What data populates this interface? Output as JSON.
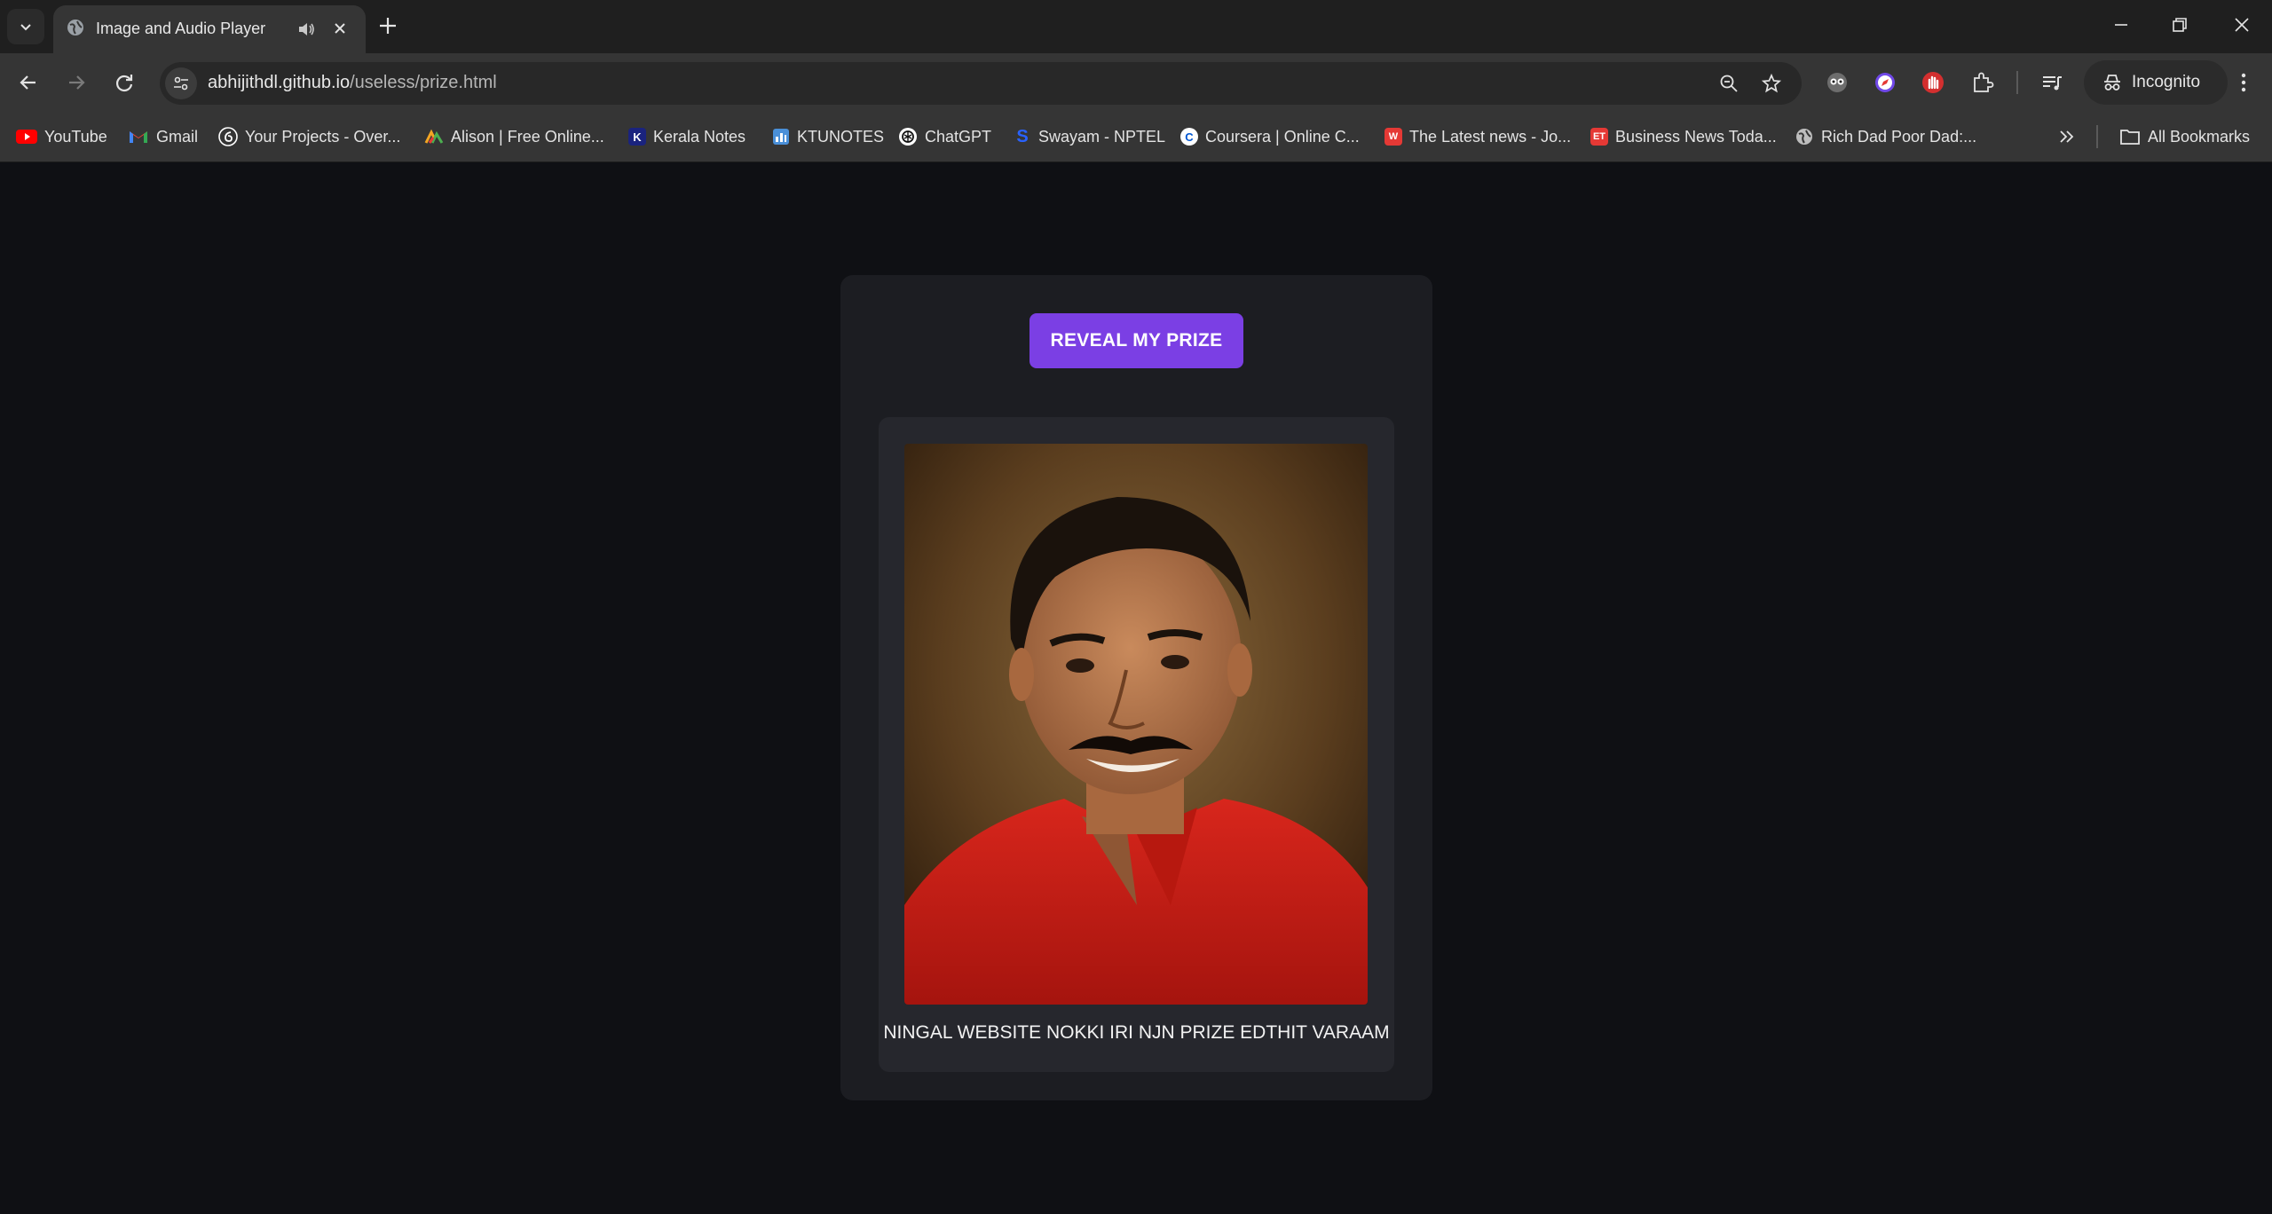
{
  "browser": {
    "tab_title": "Image and Audio Player",
    "url_host": "abhijithdl.github.io",
    "url_path": "/useless/prize.html",
    "mode_label": "Incognito"
  },
  "bookmarks": [
    {
      "label": "YouTube",
      "icon": "youtube-icon",
      "color": "#ff0000"
    },
    {
      "label": "Gmail",
      "icon": "gmail-icon",
      "color": "#ea4335"
    },
    {
      "label": "Your Projects - Over...",
      "icon": "projects-icon",
      "color": "#ffffff"
    },
    {
      "label": "Alison | Free Online...",
      "icon": "alison-icon",
      "color": "#f5a623"
    },
    {
      "label": "Kerala Notes",
      "icon": "kerala-notes-icon",
      "color": "#1a237e",
      "glyph": "K"
    },
    {
      "label": "KTUNOTES",
      "icon": "ktunotes-icon",
      "color": "#4a90d9"
    },
    {
      "label": "ChatGPT",
      "icon": "chatgpt-icon",
      "color": "#ffffff"
    },
    {
      "label": "Swayam - NPTEL",
      "icon": "swayam-icon",
      "color": "#2962ff",
      "glyph": "S"
    },
    {
      "label": "Coursera | Online C...",
      "icon": "coursera-icon",
      "color": "#0056d2",
      "glyph": "C"
    },
    {
      "label": "The Latest news - Jo...",
      "icon": "news-icon",
      "color": "#e53935",
      "glyph": "W"
    },
    {
      "label": "Business News Toda...",
      "icon": "et-icon",
      "color": "#e53935",
      "glyph": "ET"
    },
    {
      "label": "Rich Dad Poor Dad:...",
      "icon": "globe-icon",
      "color": "#bdbdbd"
    }
  ],
  "all_bookmarks_label": "All Bookmarks",
  "page": {
    "button_label": "REVEAL MY PRIZE",
    "caption": "NINGAL WEBSITE NOKKI IRI NJN PRIZE EDTHIT VARAAM",
    "accent_color": "#7b3fe4"
  }
}
